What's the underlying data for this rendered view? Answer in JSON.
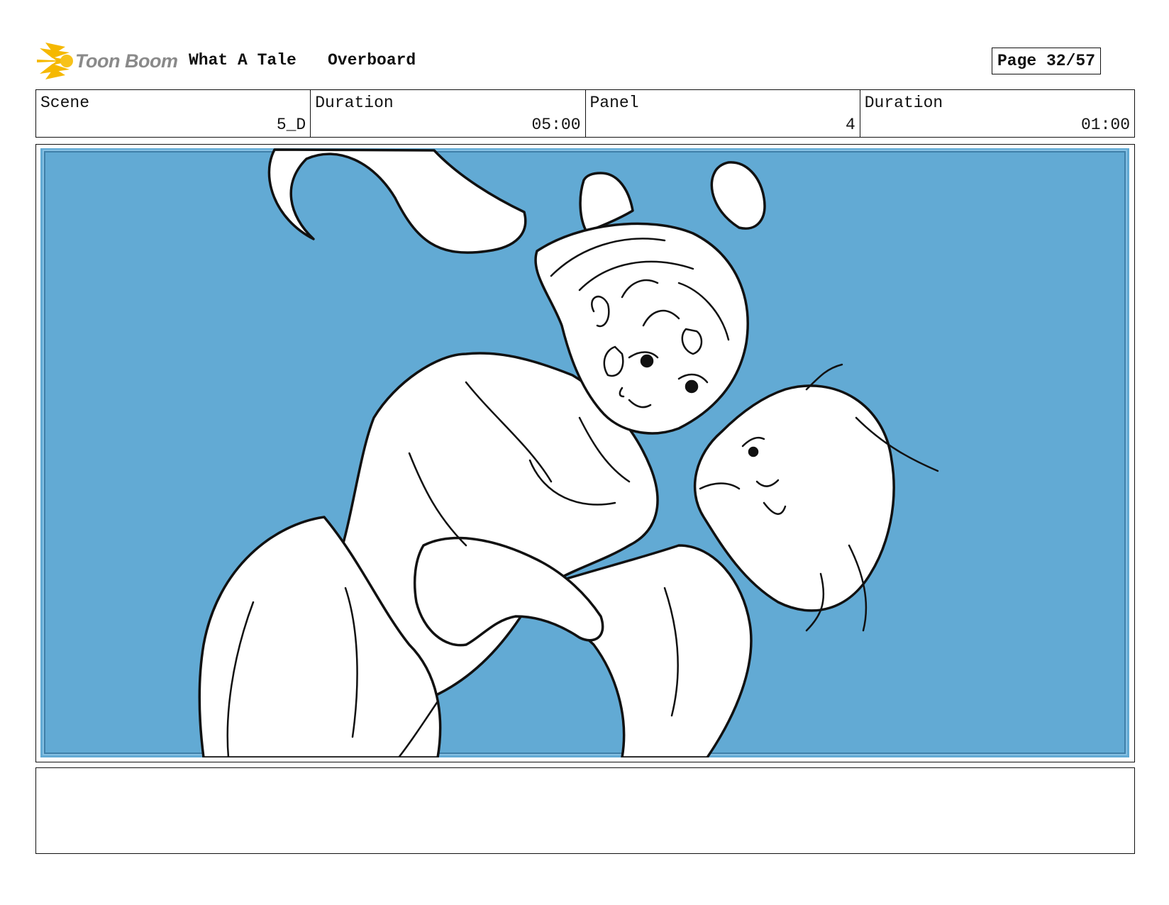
{
  "header": {
    "logo_text": "Toon Boom",
    "project_title": "What A Tale",
    "episode_title": "Overboard",
    "page_label": "Page 32/57"
  },
  "info": {
    "scene_label": "Scene",
    "scene_value": "5_D",
    "scene_duration_label": "Duration",
    "scene_duration_value": "05:00",
    "panel_label": "Panel",
    "panel_value": "4",
    "panel_duration_label": "Duration",
    "panel_duration_value": "01:00"
  },
  "colors": {
    "panel_background": "#62aad4",
    "logo_accent": "#f5b800",
    "line": "#111111"
  }
}
